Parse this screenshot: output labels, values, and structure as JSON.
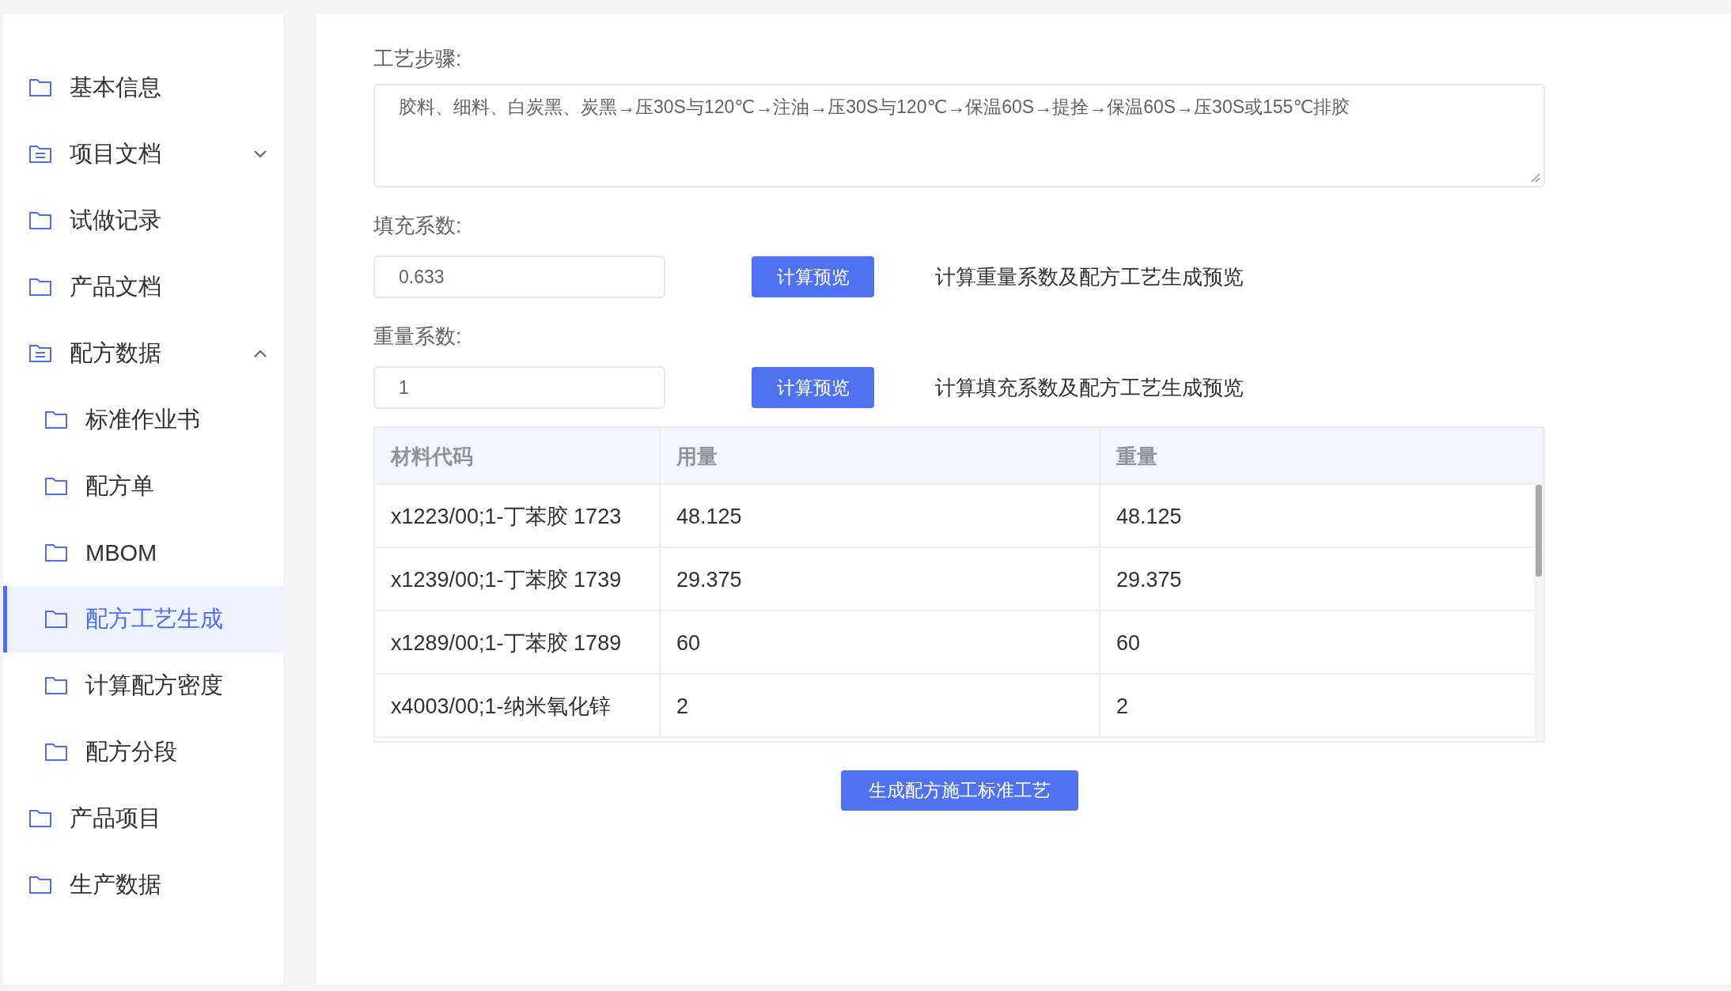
{
  "sidebar": {
    "items": [
      {
        "label": "基本信息",
        "kind": "folder",
        "selected": false
      },
      {
        "label": "项目文档",
        "kind": "list-folder",
        "selected": false,
        "expanded": false
      },
      {
        "label": "试做记录",
        "kind": "folder",
        "selected": false
      },
      {
        "label": "产品文档",
        "kind": "folder",
        "selected": false
      },
      {
        "label": "配方数据",
        "kind": "list-folder",
        "selected": false,
        "expanded": true,
        "children": [
          {
            "label": "标准作业书",
            "kind": "folder",
            "selected": false
          },
          {
            "label": "配方单",
            "kind": "folder",
            "selected": false
          },
          {
            "label": "MBOM",
            "kind": "folder",
            "selected": false
          },
          {
            "label": "配方工艺生成",
            "kind": "folder",
            "selected": true
          },
          {
            "label": "计算配方密度",
            "kind": "folder",
            "selected": false
          },
          {
            "label": "配方分段",
            "kind": "folder",
            "selected": false
          }
        ]
      },
      {
        "label": "产品项目",
        "kind": "folder",
        "selected": false
      },
      {
        "label": "生产数据",
        "kind": "folder",
        "selected": false
      }
    ]
  },
  "form": {
    "process_label": "工艺步骤:",
    "process_value": "胶料、细料、白炭黑、炭黑→压30S与120℃→注油→压30S与120℃→保温60S→提拴→保温60S→压30S或155℃排胶",
    "coefficients": [
      {
        "label": "填充系数:",
        "value": "0.633",
        "button": "计算预览",
        "hint": "计算重量系数及配方工艺生成预览"
      },
      {
        "label": "重量系数:",
        "value": "1",
        "button": "计算预览",
        "hint": "计算填充系数及配方工艺生成预览"
      }
    ]
  },
  "table": {
    "columns": [
      "材料代码",
      "用量",
      "重量"
    ],
    "rows": [
      [
        "x1223/00;1-丁苯胶 1723",
        "48.125",
        "48.125"
      ],
      [
        "x1239/00;1-丁苯胶 1739",
        "29.375",
        "29.375"
      ],
      [
        "x1289/00;1-丁苯胶 1789",
        "60",
        "60"
      ],
      [
        "x4003/00;1-纳米氧化锌",
        "2",
        "2"
      ]
    ]
  },
  "generate_button": "生成配方施工标准工艺"
}
